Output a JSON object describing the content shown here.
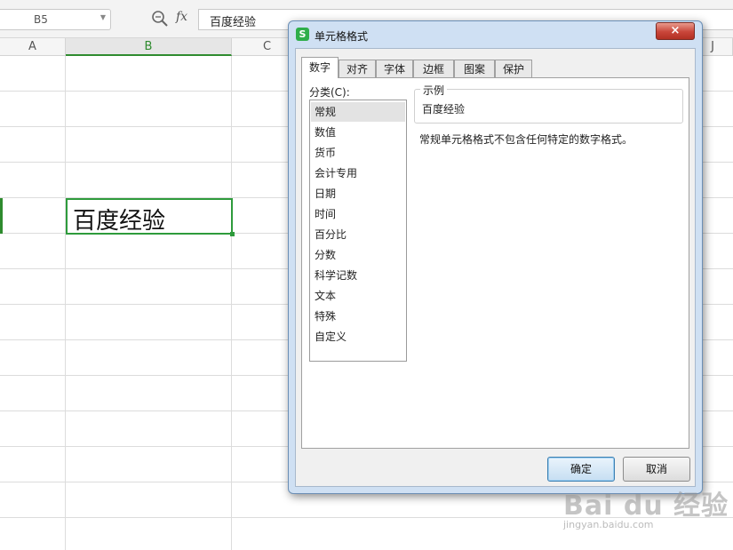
{
  "formula_bar": {
    "cell_reference": "B5",
    "fx_label": "fx",
    "formula_value": "百度经验"
  },
  "sheet": {
    "column_headers": [
      "A",
      "B",
      "C",
      "J"
    ],
    "active_cell_value": "百度经验"
  },
  "dialog": {
    "title": "单元格格式",
    "app_icon_letter": "S",
    "close_label": "×",
    "tabs": [
      {
        "label": "数字",
        "active": true
      },
      {
        "label": "对齐",
        "active": false
      },
      {
        "label": "字体",
        "active": false
      },
      {
        "label": "边框",
        "active": false
      },
      {
        "label": "图案",
        "active": false
      },
      {
        "label": "保护",
        "active": false
      }
    ],
    "category_label": "分类(C):",
    "categories": [
      {
        "label": "常规",
        "selected": true
      },
      {
        "label": "数值",
        "selected": false
      },
      {
        "label": "货币",
        "selected": false
      },
      {
        "label": "会计专用",
        "selected": false
      },
      {
        "label": "日期",
        "selected": false
      },
      {
        "label": "时间",
        "selected": false
      },
      {
        "label": "百分比",
        "selected": false
      },
      {
        "label": "分数",
        "selected": false
      },
      {
        "label": "科学记数",
        "selected": false
      },
      {
        "label": "文本",
        "selected": false
      },
      {
        "label": "特殊",
        "selected": false
      },
      {
        "label": "自定义",
        "selected": false
      }
    ],
    "sample_label": "示例",
    "sample_value": "百度经验",
    "description": "常规单元格格式不包含任何特定的数字格式。",
    "ok_label": "确定",
    "cancel_label": "取消"
  },
  "watermark": {
    "brand": "Bai du 经验",
    "url": "jingyan.baidu.com"
  },
  "colors": {
    "accent_green": "#2e9b3c",
    "dialog_frame": "#cfe0f3",
    "close_button_red": "#c9463a",
    "ok_button_blue": "#3c7fb1"
  }
}
